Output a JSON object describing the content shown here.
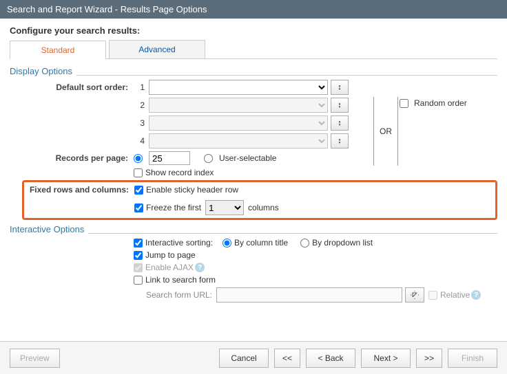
{
  "title": "Search and Report Wizard - Results Page Options",
  "subtitle": "Configure your search results:",
  "tabs": {
    "standard": "Standard",
    "advanced": "Advanced"
  },
  "displayOptions": {
    "heading": "Display Options",
    "sortLabel": "Default sort order:",
    "sortNums": [
      "1",
      "2",
      "3",
      "4"
    ],
    "orText": "OR",
    "randomOrder": "Random order",
    "recordsLabel": "Records per page:",
    "recordsValue": "25",
    "userSelectable": "User-selectable",
    "showIndex": "Show record index",
    "fixedLabel": "Fixed rows and columns:",
    "enableSticky": "Enable sticky header row",
    "freezePrefix": "Freeze the first",
    "freezeValue": "1",
    "freezeSuffix": "columns"
  },
  "interactiveOptions": {
    "heading": "Interactive Options",
    "interactiveSorting": "Interactive sorting:",
    "byColumn": "By column title",
    "byDropdown": "By dropdown list",
    "jumpToPage": "Jump to page",
    "enableAjax": "Enable AJAX",
    "linkToSearch": "Link to search form",
    "searchFormUrlLabel": "Search form URL:",
    "relative": "Relative"
  },
  "footer": {
    "preview": "Preview",
    "cancel": "Cancel",
    "first": "<<",
    "back": "< Back",
    "next": "Next >",
    "last": ">>",
    "finish": "Finish"
  }
}
